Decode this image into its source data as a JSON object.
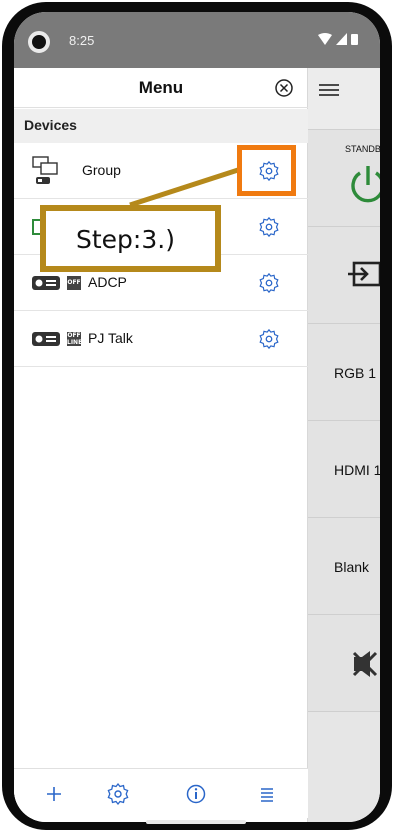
{
  "status_bar": {
    "time": "8:25"
  },
  "drawer": {
    "title": "Menu",
    "section_label": "Devices",
    "devices": [
      {
        "name": "Group",
        "type": "group"
      },
      {
        "name": "",
        "type": "projector"
      },
      {
        "name": "ADCP",
        "type": "projector",
        "badge": [
          "OFF"
        ]
      },
      {
        "name": "PJ Talk",
        "type": "projector",
        "badge": [
          "OFF",
          "LINE"
        ]
      }
    ]
  },
  "right_panel": {
    "standby_label": "STANDBY",
    "inputs": [
      "RGB 1",
      "HDMI 1",
      "Blank"
    ]
  },
  "annotation": {
    "callout": "Step:3.)"
  },
  "colors": {
    "accent": "#2a66c9",
    "power_green": "#2e8b3a",
    "highlight_orange": "#f07a10",
    "callout_gold": "#b5891b"
  }
}
